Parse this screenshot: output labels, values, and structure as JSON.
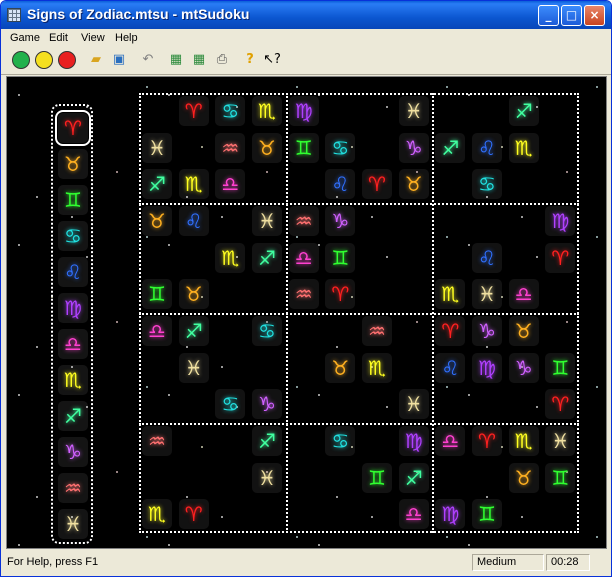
{
  "window": {
    "title": "Signs of Zodiac.mtsu - mtSudoku"
  },
  "menu": [
    "Game",
    "Edit",
    "View",
    "Help"
  ],
  "toolbar": [
    {
      "icon": "green-smiley-icon",
      "color": "#22b14c"
    },
    {
      "icon": "yellow-smiley-icon",
      "color": "#f5e020"
    },
    {
      "icon": "red-smiley-icon",
      "color": "#e82020"
    },
    {
      "icon": "open-folder-icon"
    },
    {
      "icon": "save-disk-icon"
    },
    {
      "icon": "undo-arrow-icon"
    },
    {
      "icon": "grid-solve-icon"
    },
    {
      "icon": "grid-check-icon"
    },
    {
      "icon": "print-icon"
    },
    {
      "icon": "help-question-icon"
    },
    {
      "icon": "context-help-icon"
    }
  ],
  "palette": [
    {
      "sign": "♈",
      "name": "aries",
      "color": "#ff2020",
      "selected": true
    },
    {
      "sign": "♉",
      "name": "taurus",
      "color": "#ffb020"
    },
    {
      "sign": "♊",
      "name": "gemini",
      "color": "#30ff30"
    },
    {
      "sign": "♋",
      "name": "cancer",
      "color": "#20e0e0"
    },
    {
      "sign": "♌",
      "name": "leo",
      "color": "#3070ff"
    },
    {
      "sign": "♍",
      "name": "virgo",
      "color": "#b040ff"
    },
    {
      "sign": "♎",
      "name": "libra",
      "color": "#ff40d0"
    },
    {
      "sign": "♏",
      "name": "scorpio",
      "color": "#ffff20"
    },
    {
      "sign": "♐",
      "name": "sagittarius",
      "color": "#40ffa0"
    },
    {
      "sign": "♑",
      "name": "capricorn",
      "color": "#d060ff"
    },
    {
      "sign": "♒",
      "name": "aquarius",
      "color": "#ff7070"
    },
    {
      "sign": "♓",
      "name": "pisces",
      "color": "#f0e0a0"
    }
  ],
  "grid": [
    [
      "",
      "♈",
      "♋",
      "♏",
      "♍",
      "",
      "",
      "♓",
      "",
      "",
      "♐",
      "",
      "♌"
    ],
    [
      "♓",
      "",
      "♒",
      "♉",
      "♊",
      "♋",
      "",
      "♑",
      "♐",
      "♌",
      "♏",
      "",
      "♎"
    ],
    [
      "♐",
      "♏",
      "♎",
      "",
      "",
      "♌",
      "♈",
      "♉",
      "",
      "♋",
      "",
      "",
      "♑"
    ],
    [
      "♉",
      "♌",
      "",
      "♓",
      "♒",
      "♑",
      "",
      "",
      "",
      "",
      "",
      "♍",
      ""
    ],
    [
      "",
      "",
      "♏",
      "♐",
      "♎",
      "♊",
      "",
      "",
      "",
      "♌",
      "",
      "♈",
      "♓"
    ],
    [
      "♊",
      "♉",
      "",
      "",
      "♒",
      "♈",
      "",
      "",
      "♏",
      "♓",
      "♎",
      "",
      "♋"
    ],
    [
      "♎",
      "♐",
      "",
      "♋",
      "",
      "",
      "♒",
      "",
      "♈",
      "♑",
      "♉",
      "",
      "♏"
    ],
    [
      "",
      "♓",
      "",
      "",
      "",
      "♉",
      "♏",
      "",
      "♌",
      "♍",
      "♑",
      "♊",
      ""
    ],
    [
      "",
      "",
      "♋",
      "♑",
      "",
      "",
      "",
      "♓",
      "",
      "",
      "",
      "♈",
      "♉"
    ],
    [
      "♒",
      "",
      "",
      "♐",
      "",
      "♋",
      "",
      "♍",
      "♎",
      "♈",
      "♏",
      "♓",
      ""
    ],
    [
      "",
      "",
      "",
      "♓",
      "",
      "",
      "♊",
      "♐",
      "",
      "",
      "♉",
      "♊",
      "♍"
    ],
    [
      "♏",
      "♈",
      "",
      "",
      "",
      "",
      "",
      "♎",
      "♍",
      "♊",
      "",
      "",
      "♐"
    ]
  ],
  "status": {
    "help": "For Help, press F1",
    "difficulty": "Medium",
    "time": "00:28"
  }
}
